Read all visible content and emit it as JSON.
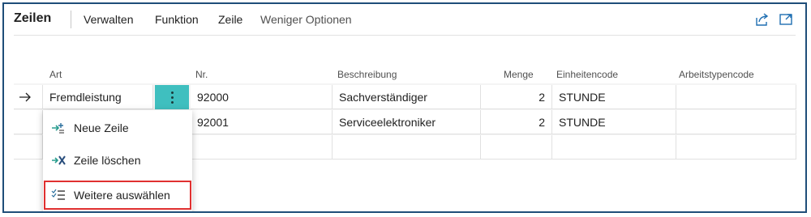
{
  "header": {
    "title": "Zeilen",
    "actions": [
      "Verwalten",
      "Funktion",
      "Zeile",
      "Weniger Optionen"
    ],
    "icons": [
      "share-icon",
      "expand-icon"
    ]
  },
  "grid": {
    "columns": [
      "Art",
      "Nr.",
      "Beschreibung",
      "Menge",
      "Einheitencode",
      "Arbeitstypencode"
    ],
    "rows": [
      {
        "art": "Fremdleistung",
        "nr": "92000",
        "beschreibung": "Sachverständiger",
        "menge": "2",
        "einheitencode": "STUNDE",
        "arbeitstypencode": ""
      },
      {
        "art": "",
        "nr": "92001",
        "beschreibung": "Serviceelektroniker",
        "menge": "2",
        "einheitencode": "STUNDE",
        "arbeitstypencode": ""
      },
      {
        "art": "",
        "nr": "",
        "beschreibung": "",
        "menge": "",
        "einheitencode": "",
        "arbeitstypencode": ""
      }
    ]
  },
  "context_menu": {
    "items": [
      {
        "label": "Neue Zeile",
        "icon": "new-line-icon"
      },
      {
        "label": "Zeile löschen",
        "icon": "delete-line-icon"
      },
      {
        "label": "Weitere auswählen",
        "icon": "select-more-icon",
        "highlighted": true
      }
    ]
  },
  "colors": {
    "frame_border": "#1f4e79",
    "dots_button": "#3fbfbf",
    "highlight": "#e03030",
    "icon_teal": "#2a9d8f"
  }
}
